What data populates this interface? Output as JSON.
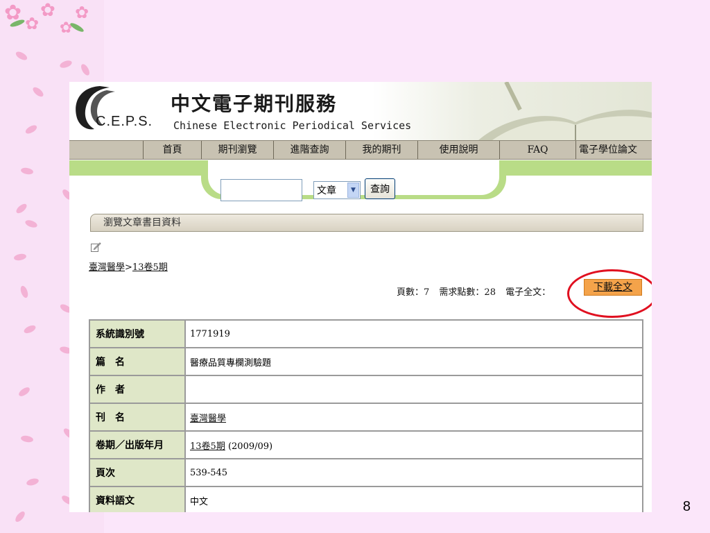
{
  "site": {
    "logo_text": "C.E.P.S.",
    "title_cn": "中文電子期刊服務",
    "title_en": "Chinese Electronic Periodical Services"
  },
  "nav": {
    "items": [
      "首頁",
      "期刊瀏覽",
      "進階查詢",
      "我的期刊",
      "使用說明",
      "FAQ",
      "電子學位論文"
    ]
  },
  "search": {
    "input_value": "",
    "select_value": "文章",
    "button_label": "查詢"
  },
  "section": {
    "title": "瀏覽文章書目資料"
  },
  "breadcrumb": {
    "journal": "臺灣醫學",
    "separator": ">",
    "issue": "13卷5期"
  },
  "stats": {
    "pages": "頁數：7",
    "points": "需求點數：28",
    "fulltext_label": "電子全文：",
    "download_label": "下載全文"
  },
  "details": {
    "rows": [
      {
        "label": "系統識別號",
        "value": "1771919"
      },
      {
        "label": "篇　名",
        "value": "醫療品質專欄測驗題"
      },
      {
        "label": "作　者",
        "value": ""
      },
      {
        "label": "刊　名",
        "value": "臺灣醫學"
      },
      {
        "label": "卷期／出版年月",
        "value": "13卷5期",
        "extra": " (2009/09)"
      },
      {
        "label": "頁次",
        "value": "539-545"
      },
      {
        "label": "資料語文",
        "value": "中文"
      }
    ]
  },
  "slide": {
    "number": "8"
  },
  "colors": {
    "background": "#fbe6fa",
    "nav": "#c8c2b2",
    "green_band": "#b9dc87",
    "label_cell": "#dfe7c8",
    "download_button": "#f4a34a",
    "highlight": "#e01020"
  }
}
